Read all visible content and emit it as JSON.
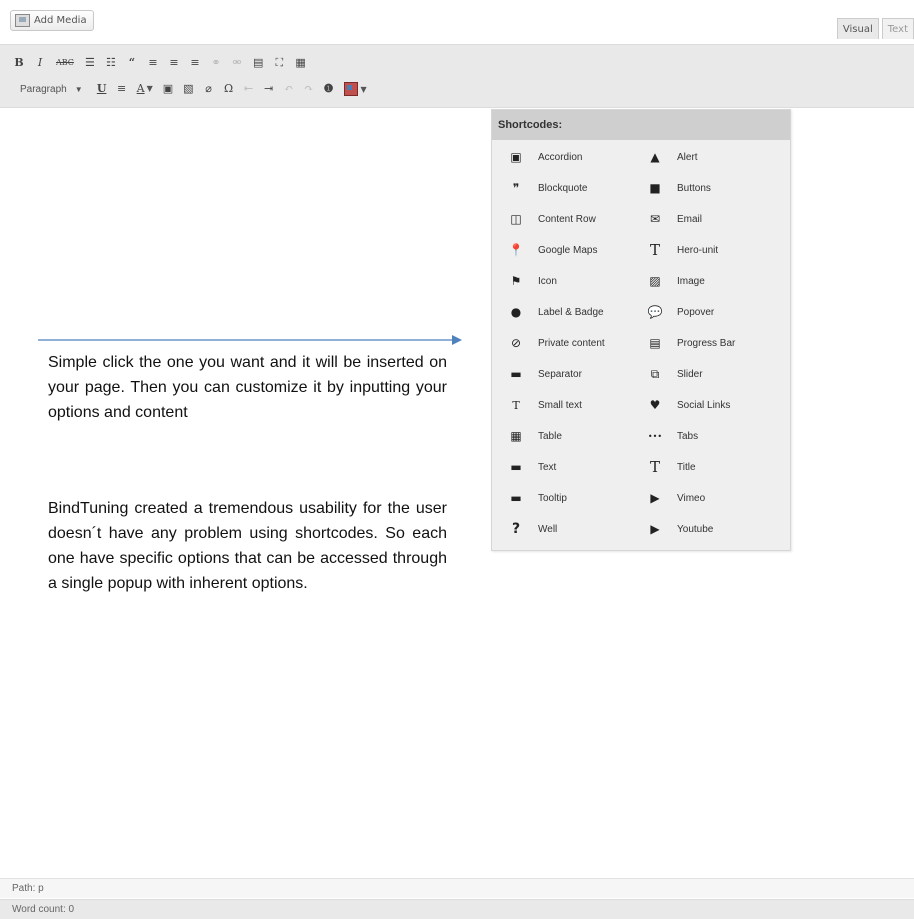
{
  "top": {
    "add_media_label": "Add Media",
    "tab_visual": "Visual",
    "tab_text": "Text"
  },
  "toolbar": {
    "row1": [
      "B",
      "I",
      "ABC",
      "list-ul",
      "list-ol",
      "“",
      "align-left",
      "align-center",
      "align-right",
      "link",
      "unlink",
      "more",
      "fullscreen",
      "kitchen-sink"
    ],
    "paragraph_label": "Paragraph",
    "underline": "U",
    "justify": "≡",
    "text_color": "A",
    "omega": "Ω"
  },
  "shortcodes": {
    "header": "Shortcodes:",
    "items": [
      {
        "label": "Accordion",
        "icon": "accordion-icon"
      },
      {
        "label": "Alert",
        "icon": "alert-icon"
      },
      {
        "label": "Blockquote",
        "icon": "quote-icon"
      },
      {
        "label": "Buttons",
        "icon": "button-icon"
      },
      {
        "label": "Content Row",
        "icon": "columns-icon"
      },
      {
        "label": "Email",
        "icon": "envelope-icon"
      },
      {
        "label": "Google Maps",
        "icon": "map-marker-icon"
      },
      {
        "label": "Hero-unit",
        "icon": "text-t-icon"
      },
      {
        "label": "Icon",
        "icon": "flag-icon"
      },
      {
        "label": "Image",
        "icon": "picture-icon"
      },
      {
        "label": "Label & Badge",
        "icon": "circle-icon"
      },
      {
        "label": "Popover",
        "icon": "speech-bubble-icon"
      },
      {
        "label": "Private content",
        "icon": "eye-off-icon"
      },
      {
        "label": "Progress Bar",
        "icon": "progress-icon"
      },
      {
        "label": "Separator",
        "icon": "minus-icon"
      },
      {
        "label": "Slider",
        "icon": "copy-icon"
      },
      {
        "label": "Small text",
        "icon": "small-text-icon"
      },
      {
        "label": "Social Links",
        "icon": "heart-icon"
      },
      {
        "label": "Table",
        "icon": "table-icon"
      },
      {
        "label": "Tabs",
        "icon": "dots-icon"
      },
      {
        "label": "Text",
        "icon": "text-block-icon"
      },
      {
        "label": "Title",
        "icon": "title-t-icon"
      },
      {
        "label": "Tooltip",
        "icon": "tooltip-icon"
      },
      {
        "label": "Vimeo",
        "icon": "vimeo-icon"
      },
      {
        "label": "Well",
        "icon": "question-icon"
      },
      {
        "label": "Youtube",
        "icon": "youtube-icon"
      }
    ]
  },
  "annotation": {
    "paragraph1": "Simple click the one you want and it will be inserted on your page. Then you can customize it by inputting your options and content",
    "paragraph2": "BindTuning created a tremendous usability for the user doesn´t have any problem using shortcodes. So each one have specific options that can be accessed through a single popup with inherent options.",
    "arrow_color": "#4f81bd"
  },
  "status": {
    "path": "Path: p",
    "word_count": "Word count: 0"
  }
}
